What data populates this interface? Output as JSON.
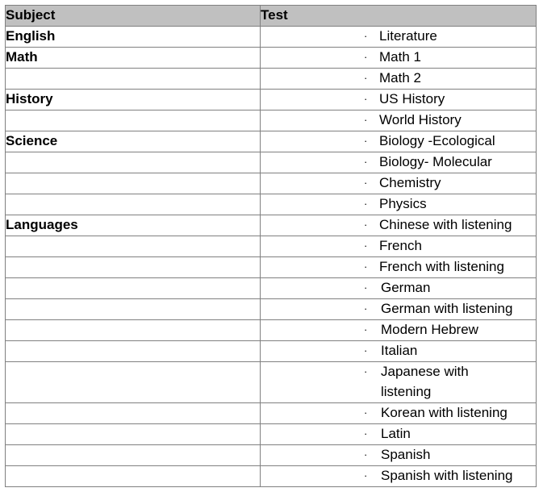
{
  "table": {
    "headers": {
      "subject": "Subject",
      "test": "Test"
    },
    "bullet_glyph": "·",
    "rows": [
      {
        "subject": "English",
        "test": "Literature"
      },
      {
        "subject": "Math",
        "test": "Math 1"
      },
      {
        "subject": "",
        "test": "Math 2"
      },
      {
        "subject": "History",
        "test": "US History"
      },
      {
        "subject": "",
        "test": "World History"
      },
      {
        "subject": "Science",
        "test": "Biology -Ecological"
      },
      {
        "subject": "",
        "test": "Biology- Molecular"
      },
      {
        "subject": "",
        "test": "Chemistry"
      },
      {
        "subject": "",
        "test": "Physics"
      },
      {
        "subject": "Languages",
        "test": "Chinese with listening"
      },
      {
        "subject": "",
        "test": "French"
      },
      {
        "subject": "",
        "test": "French with listening"
      },
      {
        "subject": "",
        "test": "German"
      },
      {
        "subject": "",
        "test": "German with listening"
      },
      {
        "subject": "",
        "test": "Modern Hebrew"
      },
      {
        "subject": "",
        "test": "Italian"
      },
      {
        "subject": "",
        "test": "Japanese with listening"
      },
      {
        "subject": "",
        "test": "Korean with listening"
      },
      {
        "subject": "",
        "test": "Latin"
      },
      {
        "subject": "",
        "test": "Spanish"
      },
      {
        "subject": "",
        "test": "Spanish with listening"
      }
    ]
  },
  "colors": {
    "header_background": "#c0c0c0",
    "border": "#808080",
    "text": "#000000"
  }
}
